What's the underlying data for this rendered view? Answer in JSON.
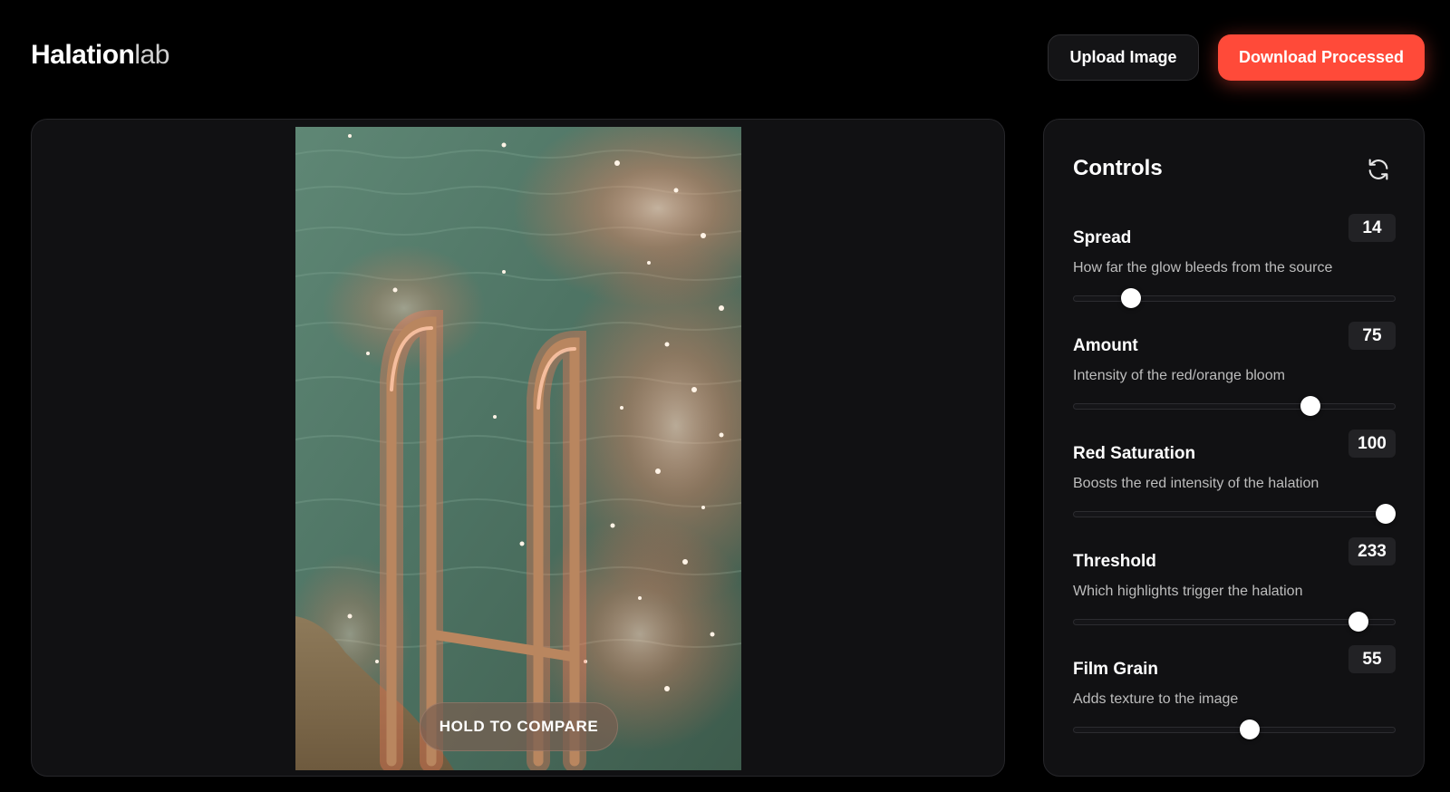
{
  "app": {
    "logo_main": "Halation",
    "logo_sub": "lab"
  },
  "header": {
    "upload_label": "Upload Image",
    "download_label": "Download Processed"
  },
  "preview": {
    "compare_label": "HOLD TO COMPARE"
  },
  "controls": {
    "title": "Controls",
    "reset_icon": "refresh-icon",
    "items": [
      {
        "label": "Spread",
        "value": "14",
        "description": "How far the glow bleeds from the source",
        "level": 0.16
      },
      {
        "label": "Amount",
        "value": "75",
        "description": "Intensity of the red/orange bloom",
        "level": 0.75
      },
      {
        "label": "Red Saturation",
        "value": "100",
        "description": "Boosts the red intensity of the halation",
        "level": 1.0
      },
      {
        "label": "Threshold",
        "value": "233",
        "description": "Which highlights trigger the halation",
        "level": 0.91
      },
      {
        "label": "Film Grain",
        "value": "55",
        "description": "Adds texture to the image",
        "level": 0.55
      }
    ]
  },
  "colors": {
    "accent": "#ff4a39",
    "background": "#000000",
    "panel": "#111113"
  }
}
